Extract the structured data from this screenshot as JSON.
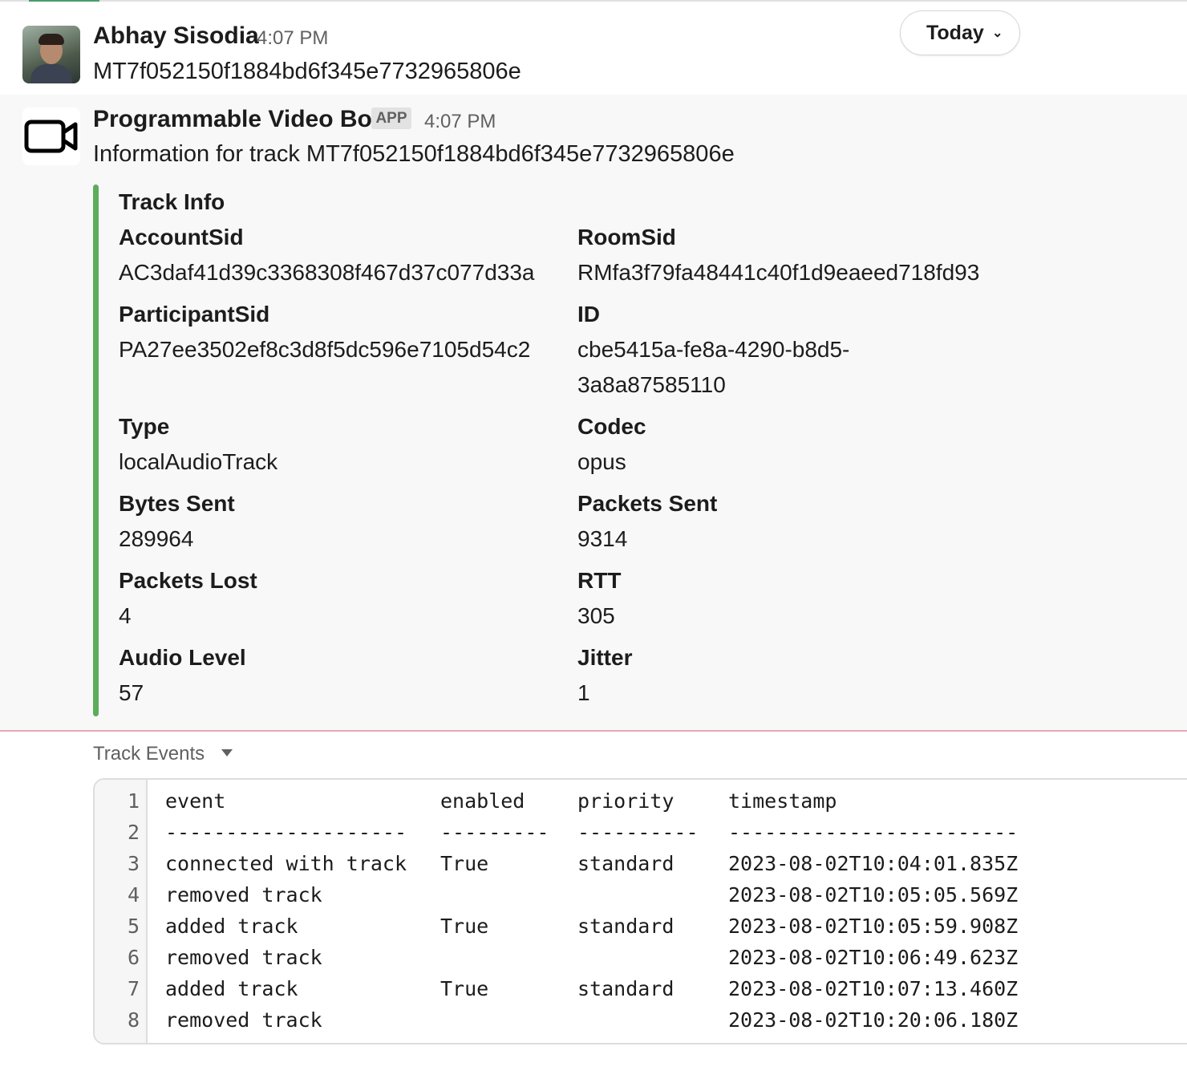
{
  "today_button": {
    "label": "Today",
    "chevron": "chevron-down-icon"
  },
  "message1": {
    "author": "Abhay Sisodia",
    "time": "4:07 PM",
    "text": "MT7f052150f1884bd6f345e7732965806e"
  },
  "message2": {
    "author": "Programmable Video Bot",
    "badge": "APP",
    "time": "4:07 PM",
    "text": "Information for track MT7f052150f1884bd6f345e7732965806e",
    "avatar_icon": "video-camera-icon",
    "attachment": {
      "title": "Track Info",
      "accent_color": "#5cac5c",
      "fields": [
        {
          "title": "AccountSid",
          "value": "AC3daf41d39c3368308f467d37c077d33a"
        },
        {
          "title": "RoomSid",
          "value": "RMfa3f79fa48441c40f1d9eaeed718fd93"
        },
        {
          "title": "ParticipantSid",
          "value": "PA27ee3502ef8c3d8f5dc596e7105d54c2"
        },
        {
          "title": "ID",
          "value_line1": "cbe5415a-fe8a-4290-b8d5-",
          "value_line2": "3a8a87585110"
        },
        {
          "title": "Type",
          "value": "localAudioTrack"
        },
        {
          "title": "Codec",
          "value": "opus"
        },
        {
          "title": "Bytes Sent",
          "value": "289964"
        },
        {
          "title": "Packets Sent",
          "value": "9314"
        },
        {
          "title": "Packets Lost",
          "value": "4"
        },
        {
          "title": "RTT",
          "value": "305"
        },
        {
          "title": "Audio Level",
          "value": "57"
        },
        {
          "title": "Jitter",
          "value": "1"
        }
      ]
    }
  },
  "track_events": {
    "title": "Track Events",
    "caret_icon": "caret-down-icon",
    "line_numbers": [
      "1",
      "2",
      "3",
      "4",
      "5",
      "6",
      "7",
      "8"
    ],
    "rows": [
      {
        "event": "event",
        "enabled": "enabled",
        "priority": "priority",
        "timestamp": "timestamp"
      },
      {
        "event": "--------------------",
        "enabled": "---------",
        "priority": "----------",
        "timestamp": "------------------------"
      },
      {
        "event": "connected with track",
        "enabled": "True",
        "priority": "standard",
        "timestamp": "2023-08-02T10:04:01.835Z"
      },
      {
        "event": "removed track",
        "enabled": "",
        "priority": "",
        "timestamp": "2023-08-02T10:05:05.569Z"
      },
      {
        "event": "added track",
        "enabled": "True",
        "priority": "standard",
        "timestamp": "2023-08-02T10:05:59.908Z"
      },
      {
        "event": "removed track",
        "enabled": "",
        "priority": "",
        "timestamp": "2023-08-02T10:06:49.623Z"
      },
      {
        "event": "added track",
        "enabled": "True",
        "priority": "standard",
        "timestamp": "2023-08-02T10:07:13.460Z"
      },
      {
        "event": "removed track",
        "enabled": "",
        "priority": "",
        "timestamp": "2023-08-02T10:20:06.180Z"
      }
    ]
  }
}
